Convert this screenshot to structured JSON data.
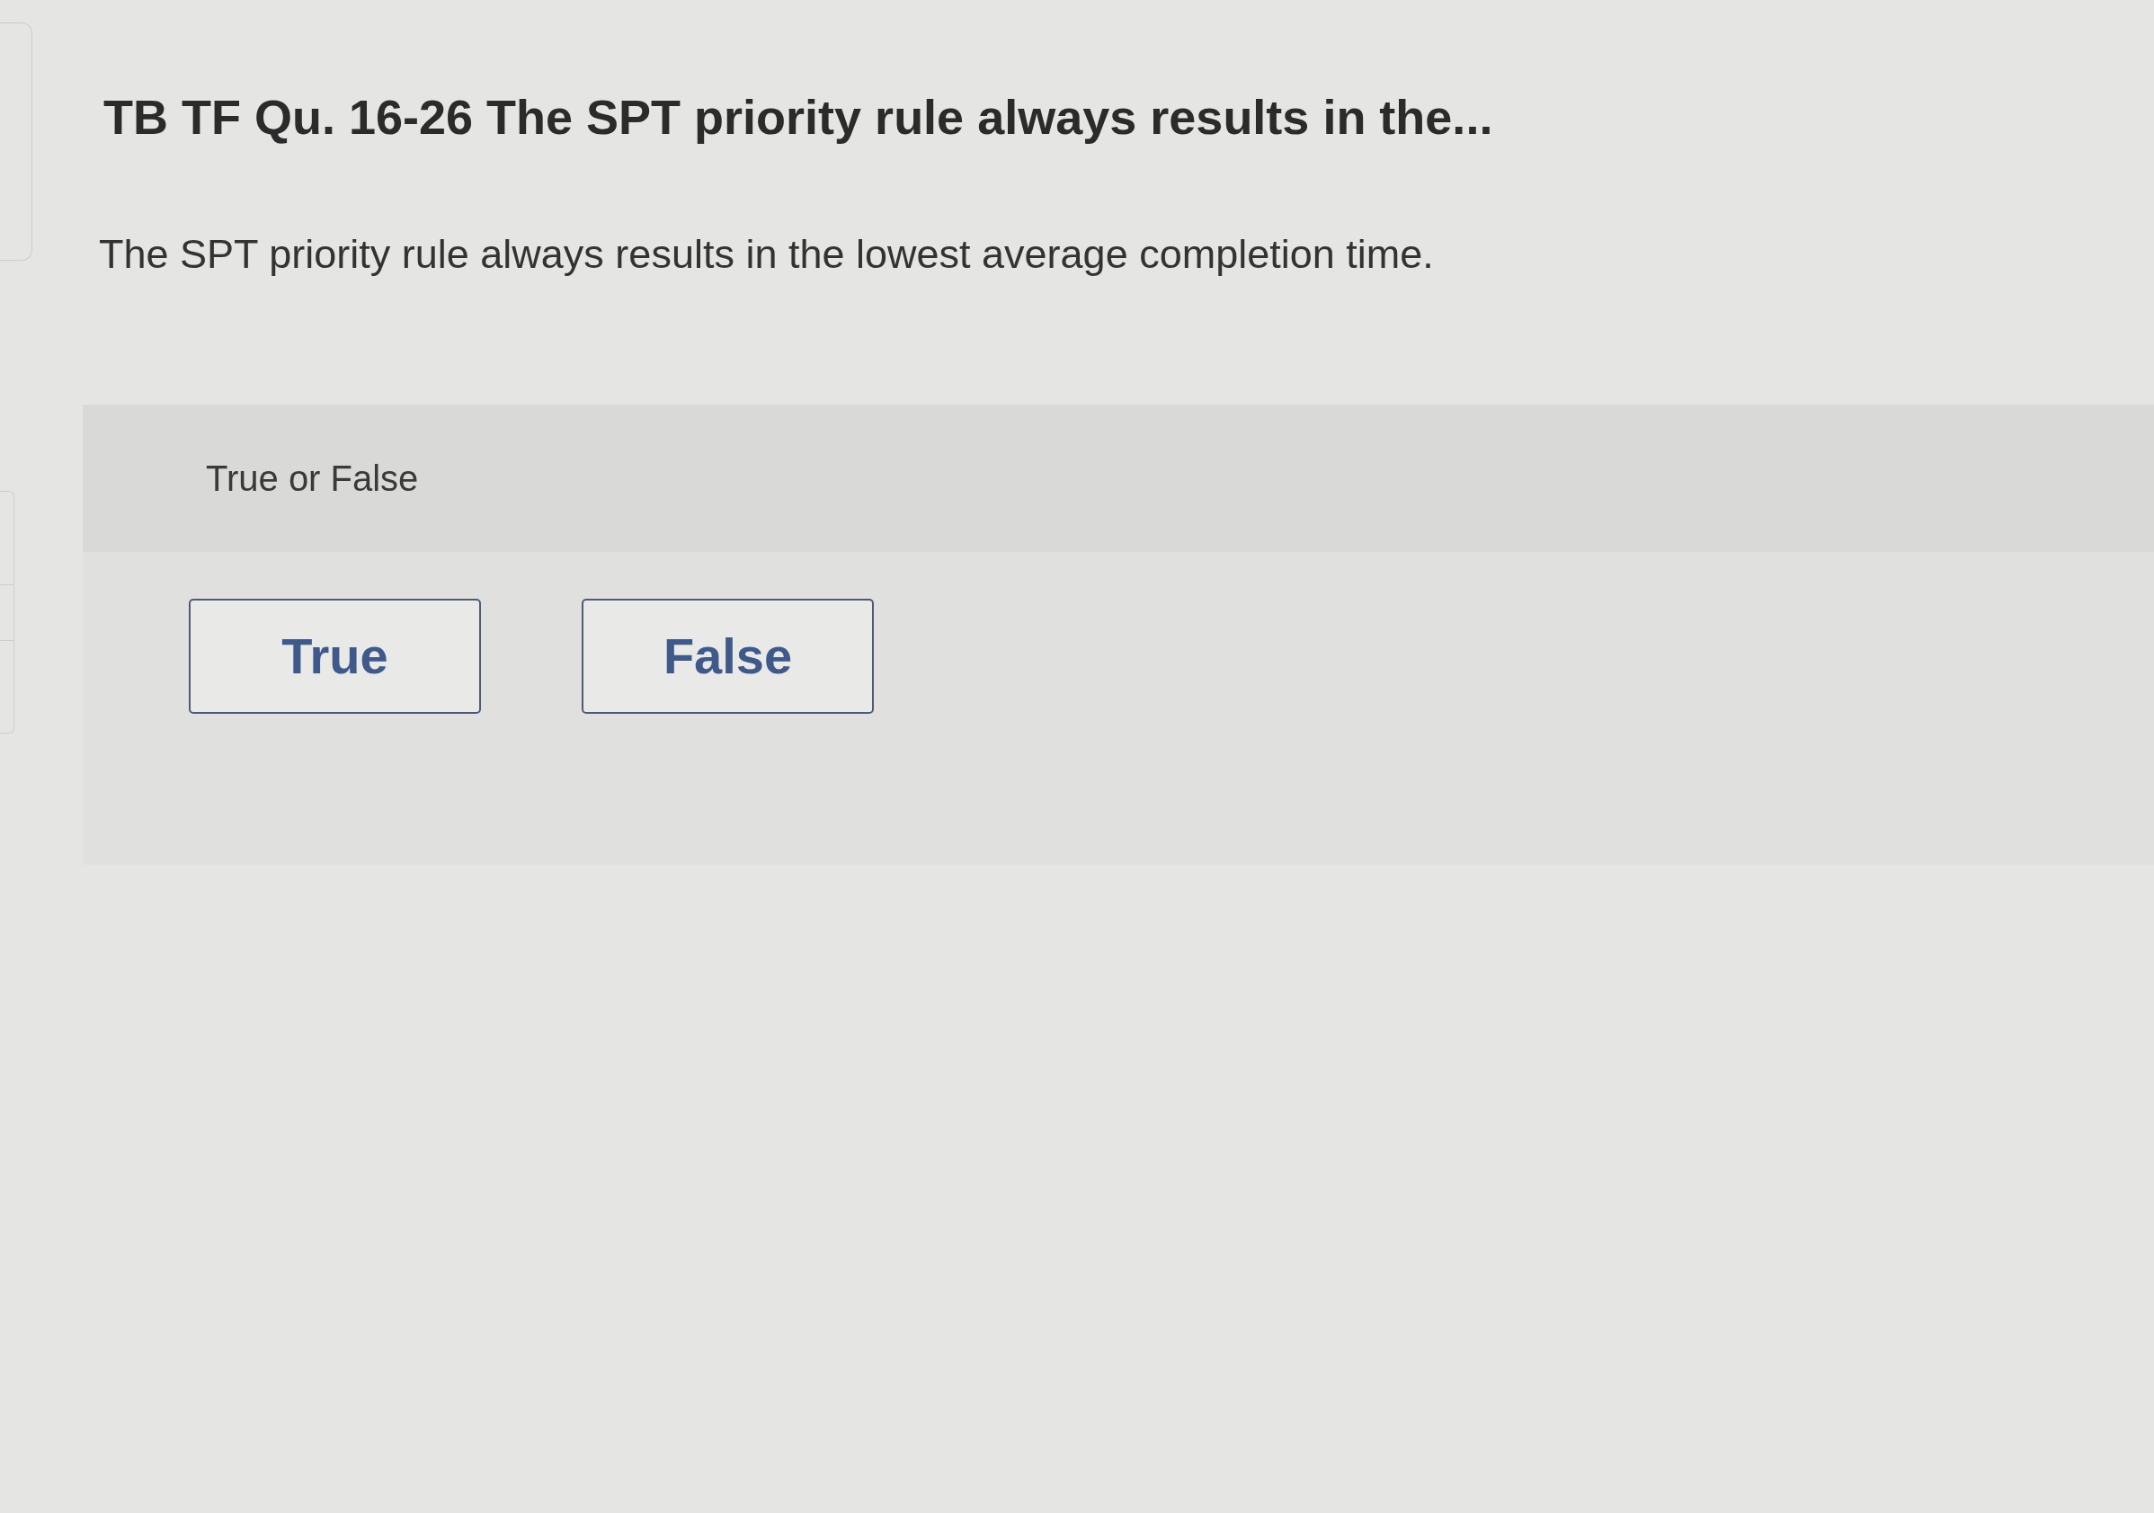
{
  "question": {
    "title": "TB TF Qu. 16-26 The SPT priority rule always results in the...",
    "prompt": "The SPT priority rule always results in the lowest average completion time."
  },
  "answer_panel": {
    "label": "True or False",
    "options": [
      {
        "label": "True",
        "selected": false
      },
      {
        "label": "False",
        "selected": false
      }
    ]
  }
}
